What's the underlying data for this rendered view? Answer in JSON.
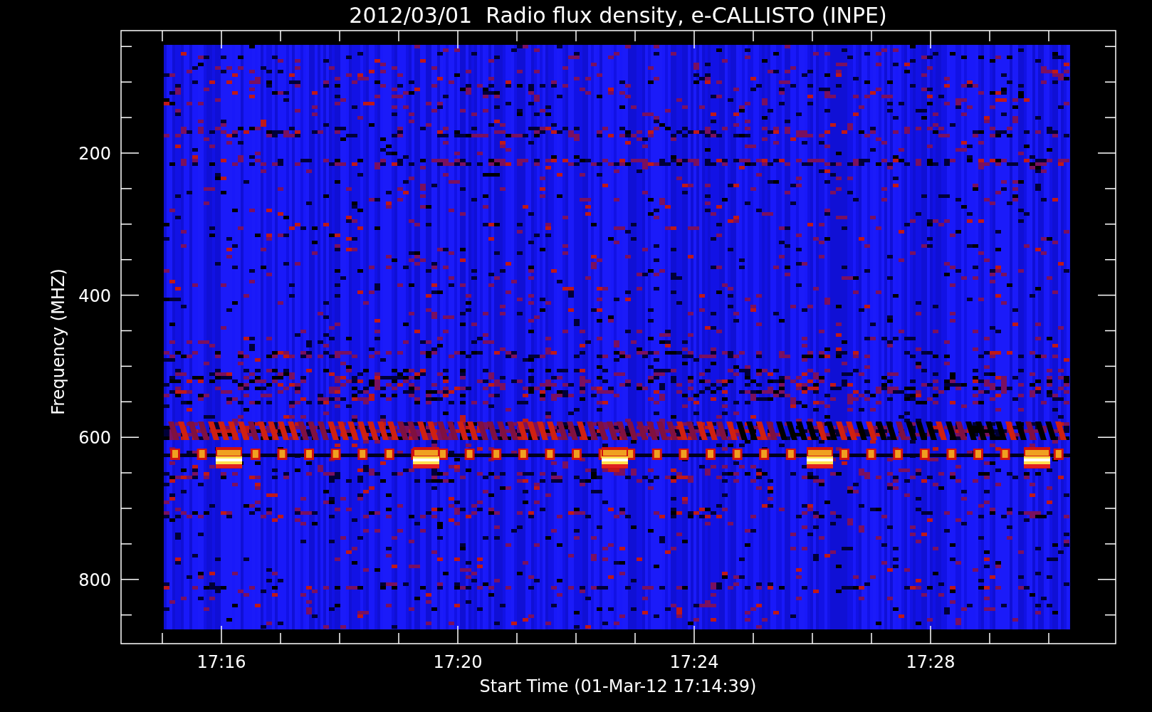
{
  "title": "2012/03/01  Radio flux density, e-CALLISTO (INPE)",
  "y_axis": {
    "label": "Frequency (MHZ)",
    "tick_labels": [
      "200",
      "400",
      "600",
      "800"
    ]
  },
  "x_axis": {
    "label": "Start Time (01-Mar-12 17:14:39)",
    "tick_labels": [
      "17:16",
      "17:20",
      "17:24",
      "17:28"
    ]
  }
}
